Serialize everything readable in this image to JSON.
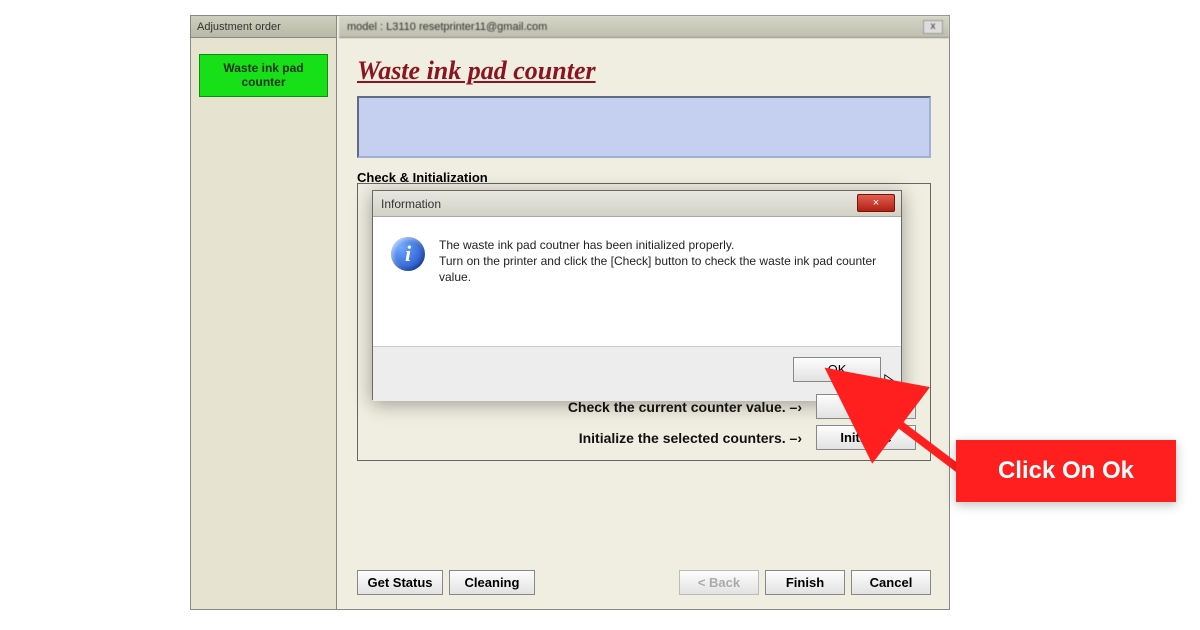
{
  "sidebar": {
    "titlebar": "Adjustment order",
    "item_line1": "Waste ink pad",
    "item_line2": "counter"
  },
  "main": {
    "titlebar": "model : L3110 resetprinter11@gmail.com",
    "heading": "Waste ink pad counter",
    "group_title": "Check & Initialization",
    "check_label": "Check the current counter value.  –›",
    "init_label": "Initialize the selected counters.  –›",
    "check_btn": "Check",
    "init_btn": "Initialize"
  },
  "dialog": {
    "title": "Information",
    "message": "The waste ink pad coutner has been initialized properly.\nTurn on the printer and click the [Check] button to check the waste ink pad counter value.",
    "ok": "OK",
    "close": "×"
  },
  "nav": {
    "get_status": "Get Status",
    "cleaning": "Cleaning",
    "back": "< Back",
    "finish": "Finish",
    "cancel": "Cancel"
  },
  "callout": {
    "text": "Click On Ok"
  },
  "icons": {
    "info_glyph": "i",
    "window_close": "x"
  }
}
